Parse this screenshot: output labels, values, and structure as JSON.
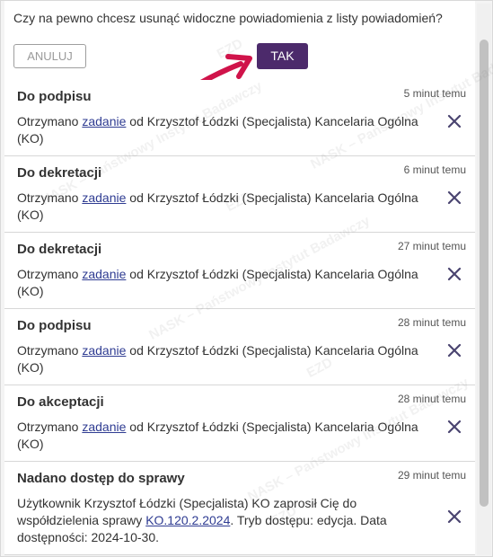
{
  "confirm": {
    "question": "Czy na pewno chcesz usunąć widoczne powiadomienia z listy powiadomień?",
    "cancel_label": "ANULUJ",
    "yes_label": "TAK"
  },
  "notifications": [
    {
      "title": "Do podpisu",
      "time": "5 minut temu",
      "prefix": "Otrzymano ",
      "link": "zadanie",
      "suffix": " od Krzysztof Łódzki (Specjalista) Kancelaria Ogólna (KO)"
    },
    {
      "title": "Do dekretacji",
      "time": "6 minut temu",
      "prefix": "Otrzymano ",
      "link": "zadanie",
      "suffix": " od Krzysztof Łódzki (Specjalista) Kancelaria Ogólna (KO)"
    },
    {
      "title": "Do dekretacji",
      "time": "27 minut temu",
      "prefix": "Otrzymano ",
      "link": "zadanie",
      "suffix": " od Krzysztof Łódzki (Specjalista) Kancelaria Ogólna (KO)"
    },
    {
      "title": "Do podpisu",
      "time": "28 minut temu",
      "prefix": "Otrzymano ",
      "link": "zadanie",
      "suffix": " od Krzysztof Łódzki (Specjalista) Kancelaria Ogólna (KO)"
    },
    {
      "title": "Do akceptacji",
      "time": "28 minut temu",
      "prefix": "Otrzymano ",
      "link": "zadanie",
      "suffix": " od Krzysztof Łódzki (Specjalista) Kancelaria Ogólna (KO)"
    },
    {
      "title": "Nadano dostęp do sprawy",
      "time": "29 minut temu",
      "prefix": "Użytkownik Krzysztof Łódzki (Specjalista) KO zaprosił Cię do współdzielenia sprawy ",
      "link": "KO.120.2.2024",
      "suffix": ". Tryb dostępu: edycja. Data dostępności: 2024-10-30."
    }
  ],
  "watermark": {
    "brand": "EZD",
    "institution": "NASK – Państwowy Instytut Badawczy"
  },
  "colors": {
    "accent": "#4c2a6b",
    "link": "#2f3c92",
    "arrow": "#d0134a",
    "close": "#4a4470"
  },
  "icons": {
    "close": "close-icon",
    "arrow": "arrow-annotation-icon"
  }
}
